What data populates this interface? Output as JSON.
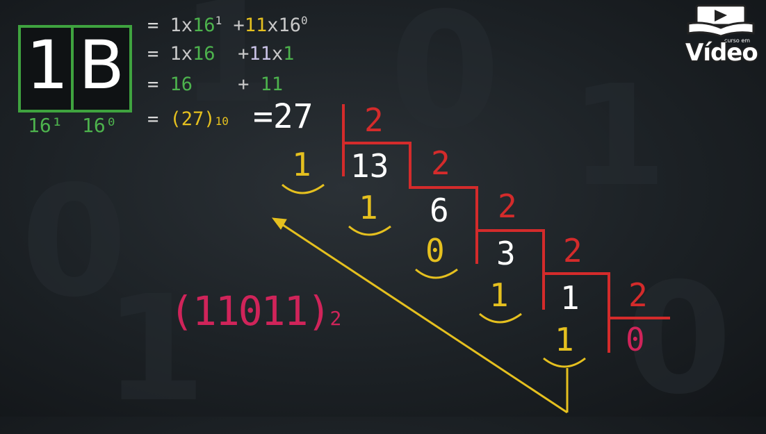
{
  "logo": {
    "small_text": "curso em",
    "main_text": "Vídeo"
  },
  "hex": {
    "digit1": "1",
    "digit2": "B",
    "pow1": "16¹",
    "pow0": "16⁰"
  },
  "expansion": {
    "line1": {
      "eq": "=",
      "a": "1x",
      "a_base": "16",
      "a_exp": "1",
      "plus": "+",
      "b": "11",
      "b_x": "x16",
      "b_exp": "0"
    },
    "line2": {
      "eq": "=",
      "a": "1x",
      "a_val": "16",
      "plus": "+",
      "b": "11",
      "b_x": "x",
      "b_val": "1"
    },
    "line3": {
      "eq": "=",
      "a": "16",
      "plus": "+",
      "b": "11"
    },
    "line4": {
      "eq": "=",
      "open": "(27)",
      "sub": "10",
      "result": "=27"
    }
  },
  "division": {
    "divisors": [
      "2",
      "2",
      "2",
      "2",
      "2"
    ],
    "quotients": [
      "13",
      "6",
      "3",
      "1"
    ],
    "remainders": [
      "1",
      "1",
      "0",
      "1",
      "1"
    ],
    "last_quotient": "0"
  },
  "binary_result": {
    "value": "(11011)",
    "base": "2"
  },
  "colors": {
    "green": "#4db34d",
    "yellow": "#e5c01f",
    "red": "#d42b2b",
    "pink": "#d0245a",
    "white": "#ffffff"
  }
}
